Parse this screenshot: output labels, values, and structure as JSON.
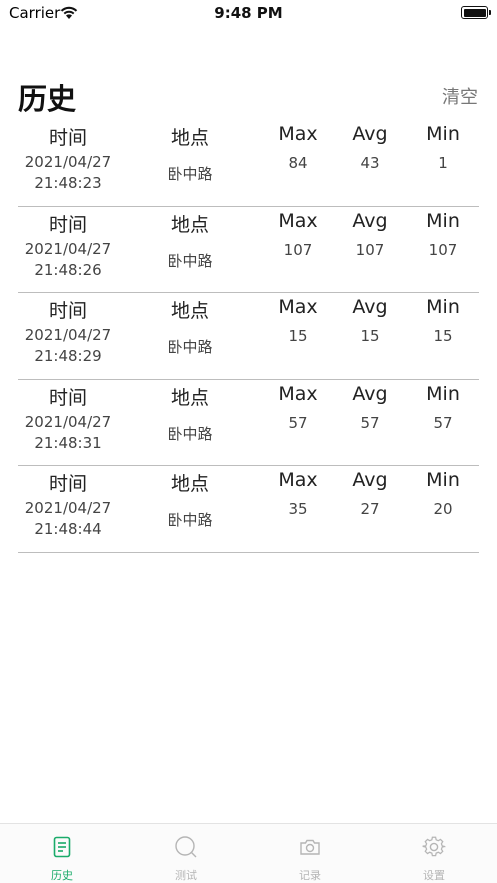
{
  "status_bar": {
    "carrier": "Carrier",
    "time": "9:48 PM"
  },
  "header": {
    "title": "历史",
    "clear_label": "清空"
  },
  "columns": {
    "time": "时间",
    "place": "地点",
    "max": "Max",
    "avg": "Avg",
    "min": "Min"
  },
  "records": [
    {
      "date": "2021/04/27",
      "time": "21:48:23",
      "place": "卧中路",
      "max": "84",
      "avg": "43",
      "min": "1"
    },
    {
      "date": "2021/04/27",
      "time": "21:48:26",
      "place": "卧中路",
      "max": "107",
      "avg": "107",
      "min": "107"
    },
    {
      "date": "2021/04/27",
      "time": "21:48:29",
      "place": "卧中路",
      "max": "15",
      "avg": "15",
      "min": "15"
    },
    {
      "date": "2021/04/27",
      "time": "21:48:31",
      "place": "卧中路",
      "max": "57",
      "avg": "57",
      "min": "57"
    },
    {
      "date": "2021/04/27",
      "time": "21:48:44",
      "place": "卧中路",
      "max": "35",
      "avg": "27",
      "min": "20"
    }
  ],
  "tab_bar": {
    "active_color": "#1aab6a",
    "inactive_color": "#b5b5b5",
    "tabs": [
      {
        "label": "历史",
        "icon": "document-icon",
        "active": true
      },
      {
        "label": "测试",
        "icon": "search-icon",
        "active": false
      },
      {
        "label": "记录",
        "icon": "camera-icon",
        "active": false
      },
      {
        "label": "设置",
        "icon": "gear-icon",
        "active": false
      }
    ]
  }
}
